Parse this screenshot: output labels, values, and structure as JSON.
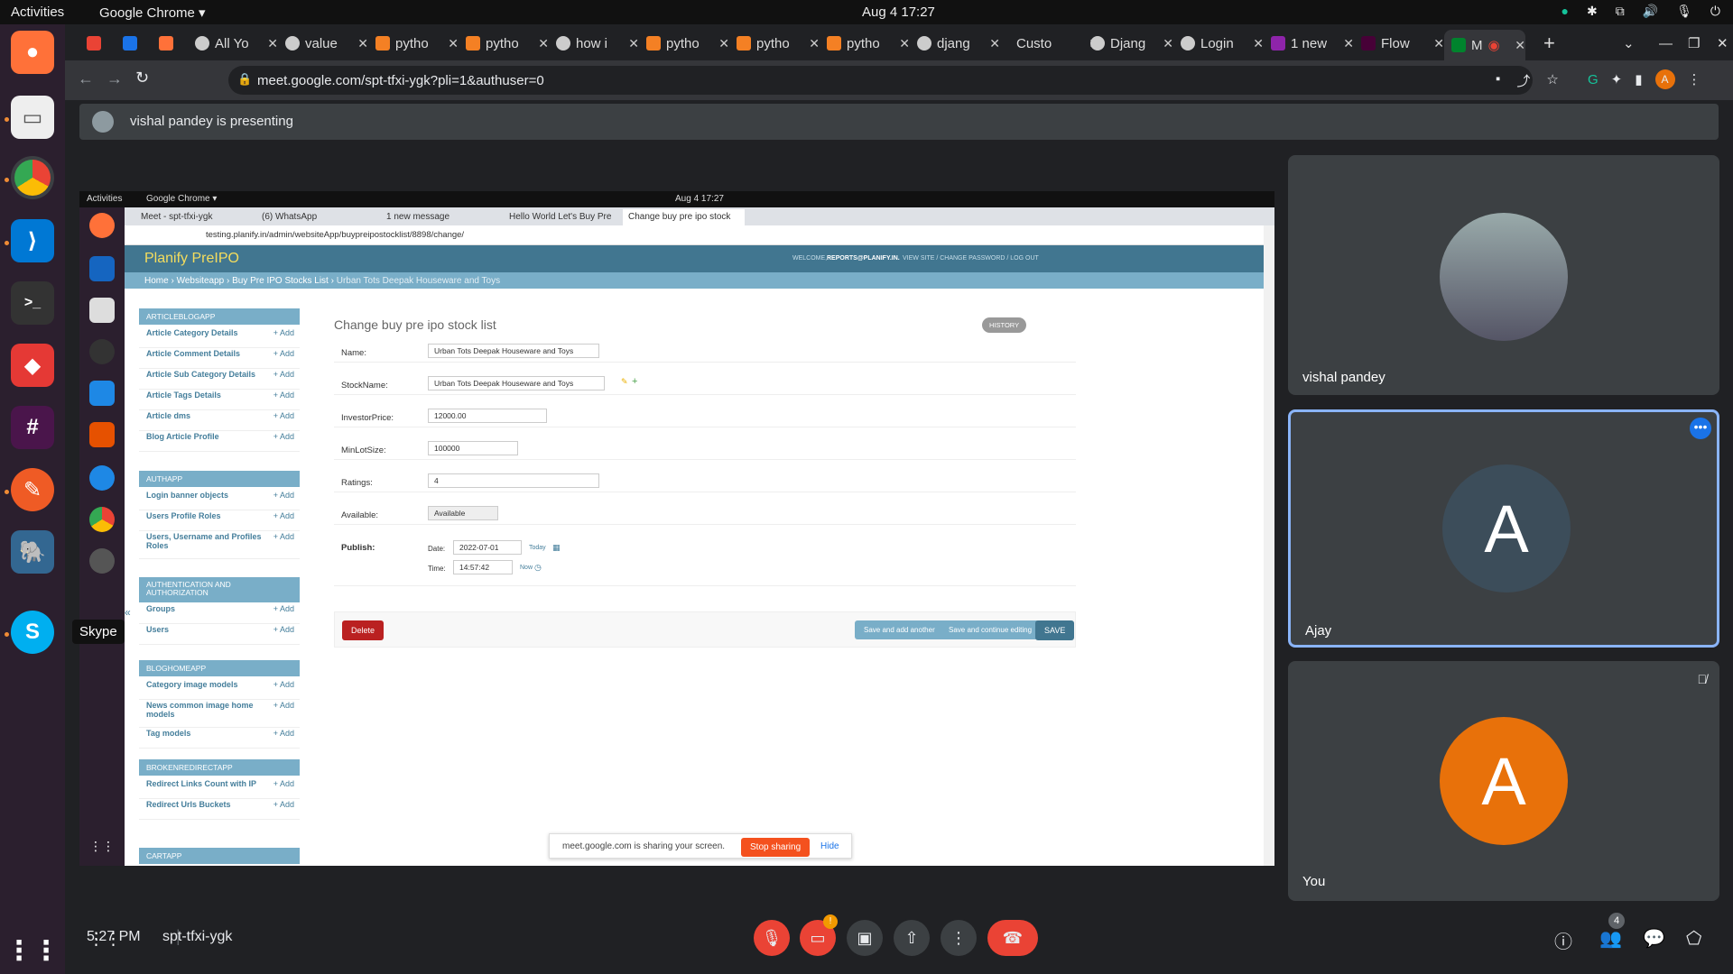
{
  "system_bar": {
    "activities": "Activities",
    "app": "Google Chrome ▾",
    "datetime": "Aug 4  17:27"
  },
  "dock": {
    "tooltip": "Skype"
  },
  "tabs": [
    {
      "label": "",
      "color": "#ea4335"
    },
    {
      "label": "",
      "color": "#1a73e8"
    },
    {
      "label": "",
      "color": "#ff7139"
    },
    {
      "label": "All Yo",
      "color": "#ccc"
    },
    {
      "label": "value",
      "color": "#ccc"
    },
    {
      "label": "pytho",
      "color": "#f48024"
    },
    {
      "label": "pytho",
      "color": "#f48024"
    },
    {
      "label": "how i",
      "color": "#ccc"
    },
    {
      "label": "pytho",
      "color": "#f48024"
    },
    {
      "label": "pytho",
      "color": "#f48024"
    },
    {
      "label": "pytho",
      "color": "#f48024"
    },
    {
      "label": "djang",
      "color": "#ccc"
    },
    {
      "label": "Custo",
      "color": "#444"
    },
    {
      "label": "Djang",
      "color": "#ccc"
    },
    {
      "label": "Login",
      "color": "#ccc"
    },
    {
      "label": "1 new",
      "color": "#8e24aa"
    },
    {
      "label": "Flow",
      "color": "#ff61f6"
    },
    {
      "label": "M",
      "color": "#00832d"
    }
  ],
  "address": {
    "url": "meet.google.com/spt-tfxi-ygk?pli=1&authuser=0"
  },
  "presenting": {
    "text": "vishal pandey is presenting"
  },
  "inner": {
    "bar": {
      "activities": "Activities",
      "app": "Google Chrome ▾",
      "datetime": "Aug 4  17:27"
    },
    "tabs": [
      "Meet - spt-tfxi-ygk",
      "(6) WhatsApp",
      "1 new message",
      "Hello World Let's Buy Pre",
      "Change buy pre ipo stock"
    ],
    "url": "testing.planify.in/admin/websiteApp/buypreipostocklist/8898/change/",
    "brand": "Planify PreIPO",
    "welcome": "WELCOME,",
    "user": "REPORTS@PLANIFY.IN.",
    "links": "VIEW SITE / CHANGE PASSWORD / LOG OUT",
    "breadcrumb": [
      "Home",
      "Websiteapp",
      "Buy Pre IPO Stocks List",
      "Urban Tots Deepak Houseware and Toys"
    ],
    "sidebar": [
      {
        "title": "ARTICLEBLOGAPP",
        "items": [
          "Article Category Details",
          "Article Comment Details",
          "Article Sub Category Details",
          "Article Tags Details",
          "Article dms",
          "Blog Article Profile"
        ]
      },
      {
        "title": "AUTHAPP",
        "items": [
          "Login banner objects",
          "Users Profile Roles",
          "Users, Username and Profiles Roles"
        ]
      },
      {
        "title": "AUTHENTICATION AND AUTHORIZATION",
        "items": [
          "Groups",
          "Users"
        ]
      },
      {
        "title": "BLOGHOMEAPP",
        "items": [
          "Category image models",
          "News common image home models",
          "Tag models"
        ]
      },
      {
        "title": "BROKENREDIRECTAPP",
        "items": [
          "Redirect Links Count with IP",
          "Redirect Urls Buckets"
        ]
      },
      {
        "title": "CARTAPP",
        "items": []
      }
    ],
    "add_label": "+ Add",
    "form": {
      "title": "Change buy pre ipo stock list",
      "history": "HISTORY",
      "name_label": "Name:",
      "name": "Urban Tots Deepak Houseware and Toys",
      "stock_label": "StockName:",
      "stock": "Urban Tots Deepak Houseware and Toys",
      "price_label": "InvestorPrice:",
      "price": "12000.00",
      "lot_label": "MinLotSize:",
      "lot": "100000",
      "ratings_label": "Ratings:",
      "ratings": "4",
      "available_label": "Available:",
      "available": "Available",
      "publish_label": "Publish:",
      "date_label": "Date:",
      "date": "2022-07-01",
      "today": "Today",
      "time_label": "Time:",
      "time": "14:57:42",
      "now": "Now",
      "delete": "Delete",
      "save_add": "Save and add another",
      "save_continue": "Save and continue editing",
      "save": "SAVE"
    },
    "share": {
      "text": "meet.google.com is sharing your screen.",
      "stop": "Stop sharing",
      "hide": "Hide"
    }
  },
  "participants": [
    {
      "name": "vishal pandey",
      "initial": "",
      "color": "#8d9aa0"
    },
    {
      "name": "Ajay",
      "initial": "A",
      "color": "#3c4d5a"
    },
    {
      "name": "You",
      "initial": "A",
      "color": "#e8710a"
    }
  ],
  "meeting": {
    "time": "5:27 PM",
    "code": "spt-tfxi-ygk",
    "people_count": "4",
    "cam_badge": "!"
  }
}
